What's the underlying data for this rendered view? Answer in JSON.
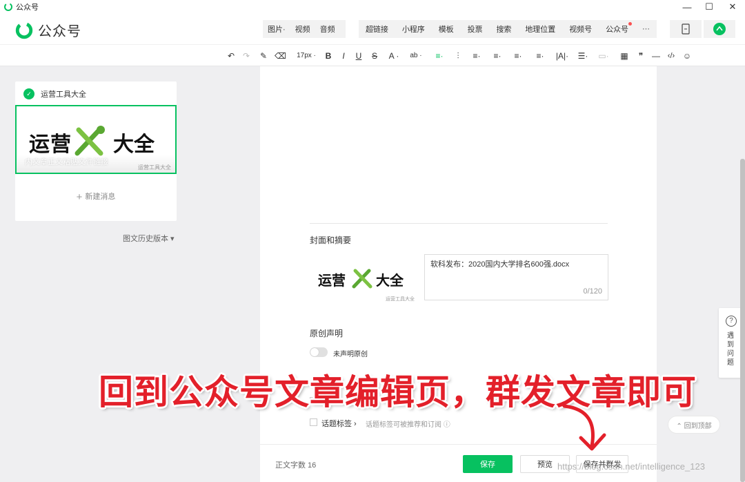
{
  "window": {
    "title": "公众号",
    "minimize": "—",
    "maximize": "☐",
    "close": "✕"
  },
  "header": {
    "brand": "公众号",
    "media_group": [
      "图片·",
      "视频",
      "音频"
    ],
    "insert_group": [
      "超链接",
      "小程序",
      "模板",
      "投票",
      "搜索",
      "地理位置",
      "视频号",
      "公众号"
    ],
    "more": "···"
  },
  "toolbar": {
    "undo": "↶",
    "redo": "↷",
    "brush": "✎",
    "clear": "⌫",
    "font_size": "17px ·",
    "bold": "B",
    "italic": "I",
    "underline": "U",
    "strike": "S",
    "font_color": "A ·",
    "bg_color": "ab ·",
    "align_left": "≡·",
    "indent": "⫶",
    "align": "≡·",
    "line_spacing": "≡·",
    "para_spacing": "≡·",
    "letter_spacing": "|A|·",
    "list": "☰·",
    "col": "▭·",
    "table": "▦",
    "quote": "❞",
    "hr": "—",
    "code": "‹/›",
    "emoji": "☺"
  },
  "left_panel": {
    "account_name": "运营工具大全",
    "cover_text_left": "运营",
    "cover_text_right": "大全",
    "cover_caption": "内文章正文粘贴文件链接",
    "cover_watermark": "运营工具大全",
    "new_message": "新建消息",
    "history": "图文历史版本 ▾"
  },
  "editor": {
    "cover_section_title": "封面和摘要",
    "cover_text_left": "运营",
    "cover_text_right": "大全",
    "cover_watermark": "运营工具大全",
    "digest_text": "软科发布：2020国内大学排名600强.docx",
    "digest_count": "0/120",
    "original_title": "原创声明",
    "original_toggle_label": "未声明原创",
    "topic_label": "话题标签 ›",
    "topic_hint": "话题标签可被推荐和订阅 ⓘ"
  },
  "bottom_bar": {
    "word_count": "正文字数  16",
    "save": "保存",
    "preview": "预览",
    "save_and_mass": "保存并群发"
  },
  "help": {
    "icon": "?",
    "text": "遇到问题"
  },
  "back_to_top": "⌃ 回到顶部",
  "annotation": "回到公众号文章编辑页，群发文章即可",
  "watermark": "https://blog.csdn.net/intelligence_123",
  "colors": {
    "brand_green": "#07c160",
    "annotation_red": "#e3202a"
  },
  "icons": [
    "app-logo-icon",
    "brand-logo-icon",
    "mobile-preview-icon",
    "avatar-icon",
    "tools-icon",
    "help-icon",
    "arrow-annotation"
  ]
}
